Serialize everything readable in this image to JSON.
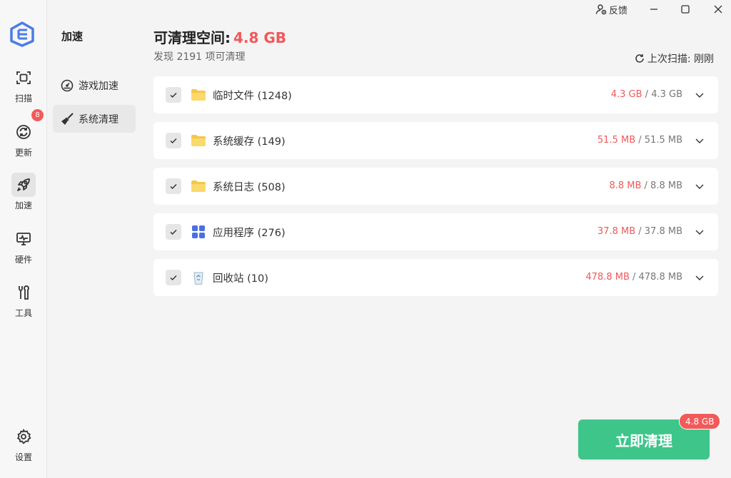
{
  "colors": {
    "accent_red": "#f0585a",
    "accent_green": "#3ec58a",
    "brand_blue": "#4a7ce8"
  },
  "rail": {
    "items": [
      {
        "label": "扫描",
        "icon": "scan-icon"
      },
      {
        "label": "更新",
        "icon": "refresh-icon",
        "badge": "8"
      },
      {
        "label": "加速",
        "icon": "rocket-icon",
        "active": true
      },
      {
        "label": "硬件",
        "icon": "monitor-icon"
      },
      {
        "label": "工具",
        "icon": "tools-icon"
      }
    ],
    "settings_label": "设置"
  },
  "subnav": {
    "title": "加速",
    "items": [
      {
        "label": "游戏加速",
        "icon": "speedometer-icon"
      },
      {
        "label": "系统清理",
        "icon": "broom-icon",
        "active": true
      }
    ]
  },
  "titlebar": {
    "feedback_label": "反馈"
  },
  "header": {
    "title_label": "可清理空间:",
    "title_size": "4.8 GB",
    "subtitle": "发现 2191 项可清理",
    "last_scan": "上次扫描: 刚刚"
  },
  "categories": [
    {
      "name": "临时文件 (1248)",
      "selected": "4.3 GB",
      "sep": " / ",
      "total": "4.3 GB",
      "icon": "folder-icon",
      "checked": true
    },
    {
      "name": "系统缓存 (149)",
      "selected": "51.5 MB",
      "sep": " / ",
      "total": "51.5 MB",
      "icon": "folder-icon",
      "checked": true
    },
    {
      "name": "系统日志 (508)",
      "selected": "8.8 MB",
      "sep": " / ",
      "total": "8.8 MB",
      "icon": "folder-icon",
      "checked": true
    },
    {
      "name": "应用程序 (276)",
      "selected": "37.8 MB",
      "sep": " / ",
      "total": "37.8 MB",
      "icon": "apps-grid-icon",
      "checked": true
    },
    {
      "name": "回收站 (10)",
      "selected": "478.8 MB",
      "sep": " / ",
      "total": "478.8 MB",
      "icon": "recycle-bin-icon",
      "checked": true
    }
  ],
  "action": {
    "clean_label": "立即清理",
    "badge": "4.8 GB"
  }
}
